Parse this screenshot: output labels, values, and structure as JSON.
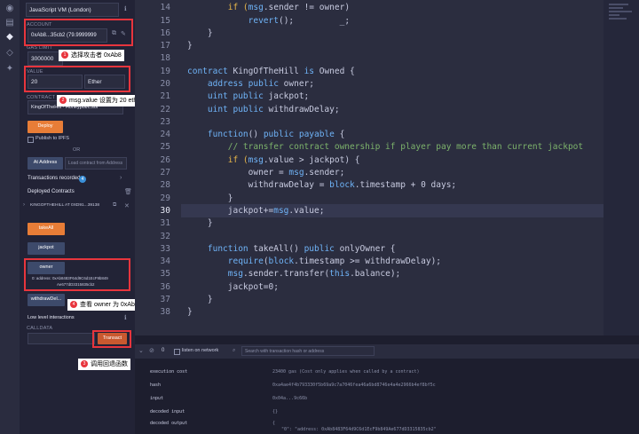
{
  "environment": {
    "value": "JavaScript VM (London)"
  },
  "account": {
    "label": "ACCOUNT",
    "value": "0xAb8...35cb2 (79.9999999"
  },
  "gas_limit": {
    "label": "GAS LIMIT",
    "value": "3000000"
  },
  "value": {
    "label": "VALUE",
    "amount": "20",
    "unit": "Ether"
  },
  "contract": {
    "label": "CONTRACT",
    "value": "KingOfTheHill - Honeypot/c.sol"
  },
  "deploy_label": "Deploy",
  "publish_label": "Publish to IPFS",
  "or_label": "OR",
  "at_address_label": "At Address",
  "load_contract_label": "Load contract from Address",
  "transactions_recorded": {
    "label": "Transactions recorded",
    "count": "4"
  },
  "deployed_contracts_label": "Deployed Contracts",
  "instance_label": "KINGOFTHEHILL AT 0XD91...39138",
  "buttons": {
    "takeAll": "takeAll",
    "jackpot": "jackpot",
    "owner": "owner",
    "withdrawDelay": "withdrawDel..."
  },
  "owner_result": {
    "line1": "0: address: 0xAb8483F64d9C6d1EcF9b849",
    "line2": "Ae677dD3315835cb2"
  },
  "low_level": {
    "label": "Low level interactions",
    "calldata": "CALLDATA",
    "transact": "Transact"
  },
  "annotations": {
    "a1": {
      "num": "1",
      "text": "选择攻击者 0xAb8"
    },
    "a2": {
      "num": "2",
      "text": "msg.value 设置为 20 eth"
    },
    "a3": {
      "num": "3",
      "text": "调用回退函数"
    },
    "a4": {
      "num": "4",
      "text": "查看 owner 为 0xAb8"
    }
  },
  "code": {
    "line_numbers": [
      "14",
      "15",
      "16",
      "17",
      "18",
      "19",
      "20",
      "21",
      "22",
      "23",
      "24",
      "25",
      "26",
      "27",
      "28",
      "29",
      "30",
      "31",
      "32",
      "33",
      "34",
      "35",
      "36",
      "37",
      "38"
    ],
    "l14_a": "        if (",
    "l14_b": "msg",
    "l14_c": ".sender != owner)",
    "l15_a": "            ",
    "l15_b": "revert",
    "l15_c": "();         _;",
    "l16": "    }",
    "l17": "}",
    "l19_kw": "contract",
    "l19_name": " KingOfTheHill ",
    "l19_kw2": "is",
    "l19_rest": " Owned {",
    "l20_kw": "    address public",
    "l20_rest": " owner;",
    "l21_kw": "    uint public",
    "l21_rest": " jackpot;",
    "l22_kw": "    uint public",
    "l22_rest": " withdrawDelay;",
    "l24_kw": "    function",
    "l24_mid": "() ",
    "l24_kw2": "public payable",
    "l24_rest": " {",
    "l25_comment": "        // transfer contract ownership if player pay more than current jackpot",
    "l26_a": "        if (",
    "l26_b": "msg",
    "l26_c": ".value > jackpot) {",
    "l27_a": "            owner = ",
    "l27_b": "msg",
    "l27_c": ".sender;",
    "l28_a": "            withdrawDelay = ",
    "l28_b": "block",
    "l28_c": ".timestamp + 0 days;",
    "l29": "        }",
    "l30_a": "        jackpot+=",
    "l30_b": "msg",
    "l30_c": ".value;",
    "l31": "    }",
    "l33_kw": "    function",
    "l33_name": " takeAll() ",
    "l33_kw2": "public",
    "l33_rest": " onlyOwner {",
    "l34_a": "        ",
    "l34_b": "require",
    "l34_c": "(",
    "l34_d": "block",
    "l34_e": ".timestamp >= withdrawDelay);",
    "l35_a": "        ",
    "l35_b": "msg",
    "l35_c": ".sender.transfer(",
    "l35_d": "this",
    "l35_e": ".balance);",
    "l36": "        jackpot=0;",
    "l37": "    }",
    "l38": "}"
  },
  "terminal": {
    "count": "0",
    "listen_label": "listen on network",
    "search_placeholder": "Search with transaction hash or address",
    "rows": [
      {
        "key": "execution cost",
        "value": "23400 gas (Cost only applies when called by a contract)"
      },
      {
        "key": "hash",
        "value": "0xa4ae4f4b793330f5b69a9c7a7046fea46a6bd8746e4a4e2966b4ef8bf5c"
      },
      {
        "key": "input",
        "value": "0x04a...9c66b"
      },
      {
        "key": "decoded input",
        "value": "{}"
      },
      {
        "key": "decoded output",
        "value": "{"
      },
      {
        "key": "",
        "value": "\"0\": \"address: 0xAb8483F64d9C6d1EcF9b849Ae677dD3315835cb2\""
      }
    ]
  }
}
